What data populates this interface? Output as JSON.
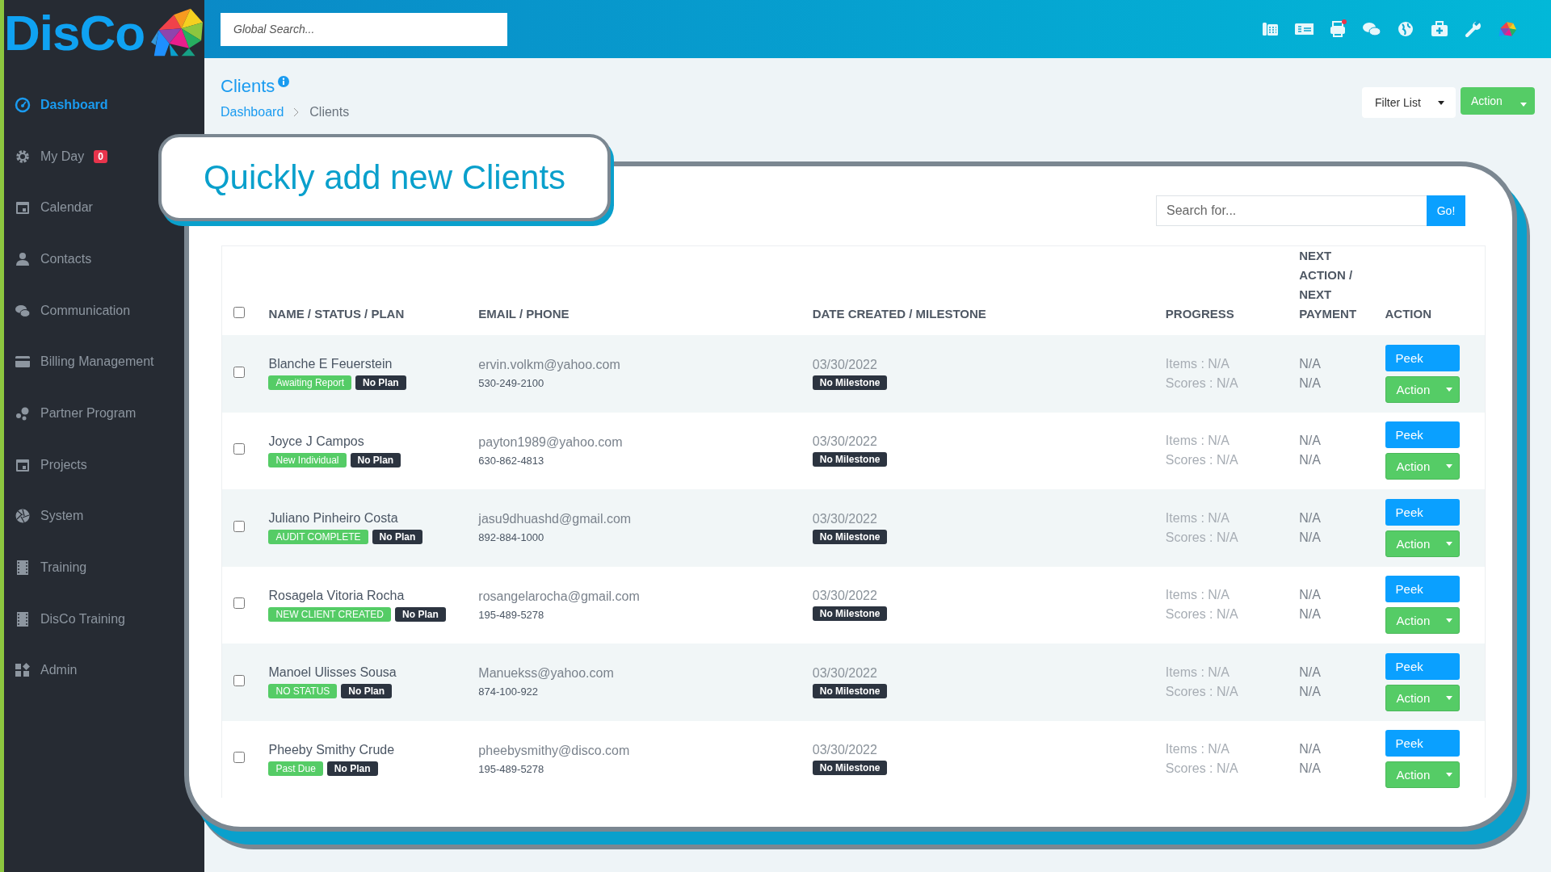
{
  "logo": {
    "text": "DisCo"
  },
  "sidebar": {
    "items": [
      {
        "label": "Dashboard",
        "selected": true
      },
      {
        "label": "My Day",
        "selected": false,
        "badge": "0"
      },
      {
        "label": "Calendar",
        "selected": false
      },
      {
        "label": "Contacts",
        "selected": false
      },
      {
        "label": "Communication",
        "selected": false
      },
      {
        "label": "Billing Management",
        "selected": false
      },
      {
        "label": "Partner Program",
        "selected": false
      },
      {
        "label": "Projects",
        "selected": false
      },
      {
        "label": "System",
        "selected": false
      },
      {
        "label": "Training",
        "selected": false
      },
      {
        "label": "DisCo Training",
        "selected": false
      },
      {
        "label": "Admin",
        "selected": false
      }
    ]
  },
  "topbar": {
    "search": {
      "placeholder": "Global Search..."
    }
  },
  "page": {
    "title": "Clients",
    "breadcrumb": [
      {
        "label": "Dashboard",
        "current": false
      },
      {
        "label": "Clients",
        "current": true
      }
    ],
    "filter_button": "Filter List",
    "action_button": "Action"
  },
  "callout": "Quickly add new Clients",
  "search": {
    "placeholder": "Search for...",
    "button": "Go!"
  },
  "table": {
    "select_all_checked": false,
    "columns": [
      "NAME / STATUS / PLAN",
      "EMAIL / PHONE",
      "DATE CREATED / MILESTONE",
      "PROGRESS",
      "NEXT ACTION / NEXT PAYMENT",
      "ACTION"
    ],
    "rows": [
      {
        "checked": false,
        "name": "Blanche E Feuerstein",
        "status": "Awaiting Report",
        "plan": "No Plan",
        "email": "ervin.volkm@yahoo.com",
        "phone": "530-249-2100",
        "date": "03/30/2022",
        "milestone": "No Milestone",
        "items": "Items : N/A",
        "scores": "Scores : N/A",
        "next_action": "N/A",
        "next_payment": "N/A",
        "peek": "Peek",
        "action": "Action"
      },
      {
        "checked": false,
        "name": "Joyce J Campos",
        "status": "New Individual",
        "plan": "No Plan",
        "email": "payton1989@yahoo.com",
        "phone": "630-862-4813",
        "date": "03/30/2022",
        "milestone": "No Milestone",
        "items": "Items : N/A",
        "scores": "Scores : N/A",
        "next_action": "N/A",
        "next_payment": "N/A",
        "peek": "Peek",
        "action": "Action"
      },
      {
        "checked": false,
        "name": "Juliano Pinheiro Costa",
        "status": "AUDIT COMPLETE",
        "plan": "No Plan",
        "email": "jasu9dhuashd@gmail.com",
        "phone": "892-884-1000",
        "date": "03/30/2022",
        "milestone": "No Milestone",
        "items": "Items : N/A",
        "scores": "Scores : N/A",
        "next_action": "N/A",
        "next_payment": "N/A",
        "peek": "Peek",
        "action": "Action"
      },
      {
        "checked": false,
        "name": "Rosagela Vitoria Rocha",
        "status": "NEW CLIENT CREATED",
        "plan": "No Plan",
        "email": "rosangelarocha@gmail.com",
        "phone": "195-489-5278",
        "date": "03/30/2022",
        "milestone": "No Milestone",
        "items": "Items : N/A",
        "scores": "Scores : N/A",
        "next_action": "N/A",
        "next_payment": "N/A",
        "peek": "Peek",
        "action": "Action"
      },
      {
        "checked": false,
        "name": "Manoel Ulisses Sousa",
        "status": "NO STATUS",
        "plan": "No Plan",
        "email": "Manuekss@yahoo.com",
        "phone": "874-100-922",
        "date": "03/30/2022",
        "milestone": "No Milestone",
        "items": "Items : N/A",
        "scores": "Scores : N/A",
        "next_action": "N/A",
        "next_payment": "N/A",
        "peek": "Peek",
        "action": "Action"
      },
      {
        "checked": false,
        "name": "Pheeby Smithy Crude",
        "status": "Past Due",
        "plan": "No Plan",
        "email": "pheebysmithy@disco.com",
        "phone": "195-489-5278",
        "date": "03/30/2022",
        "milestone": "No Milestone",
        "items": "Items : N/A",
        "scores": "Scores : N/A",
        "next_action": "N/A",
        "next_payment": "N/A",
        "peek": "Peek",
        "action": "Action"
      }
    ]
  }
}
